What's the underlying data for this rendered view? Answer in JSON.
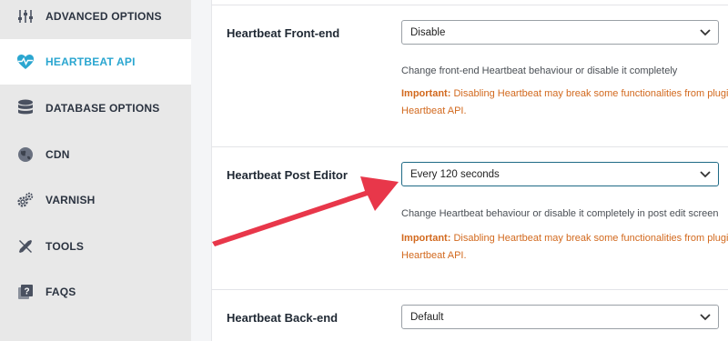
{
  "sidebar": {
    "items": [
      {
        "label": "ADVANCED OPTIONS",
        "icon": "sliders-icon"
      },
      {
        "label": "HEARTBEAT API",
        "icon": "heartbeat-icon",
        "active": true
      },
      {
        "label": "DATABASE OPTIONS",
        "icon": "database-icon"
      },
      {
        "label": "CDN",
        "icon": "globe-icon"
      },
      {
        "label": "VARNISH",
        "icon": "gears-icon"
      },
      {
        "label": "TOOLS",
        "icon": "tools-icon"
      },
      {
        "label": "FAQS",
        "icon": "faq-icon"
      }
    ]
  },
  "settings": {
    "frontend": {
      "label": "Heartbeat Front-end",
      "value": "Disable",
      "description": "Change front-end Heartbeat behaviour or disable it completely",
      "important_prefix": "Important:",
      "important_text": "Disabling Heartbeat may break some functionalities from plugi",
      "important_cont": "Heartbeat API."
    },
    "post_editor": {
      "label": "Heartbeat Post Editor",
      "value": "Every 120 seconds",
      "description": "Change Heartbeat behaviour or disable it completely in post edit screen",
      "important_prefix": "Important:",
      "important_text": "Disabling Heartbeat may break some functionalities from plugi",
      "important_cont": "Heartbeat API."
    },
    "backend": {
      "label": "Heartbeat Back-end",
      "value": "Default"
    }
  },
  "colors": {
    "accent": "#2aa6d0",
    "warning": "#d2691e",
    "arrow": "#e8374a"
  }
}
